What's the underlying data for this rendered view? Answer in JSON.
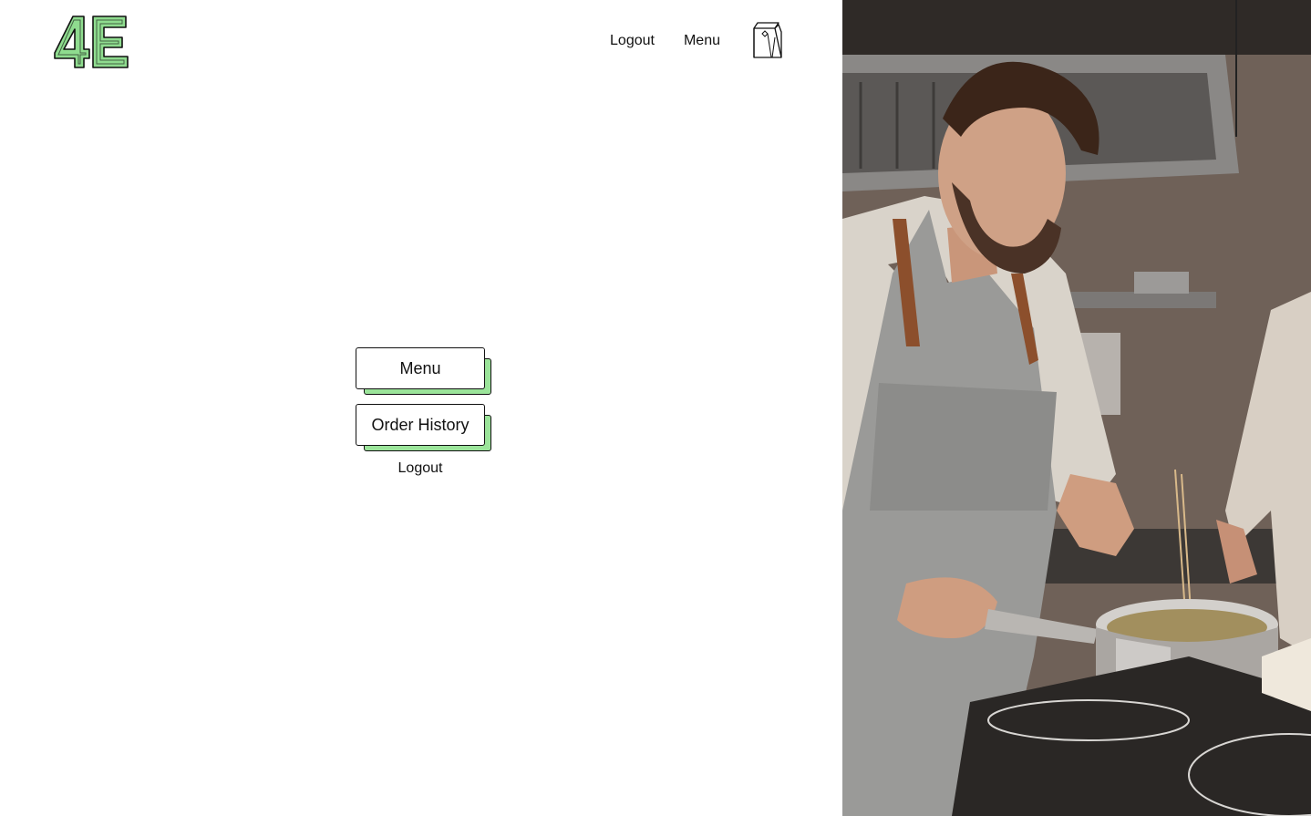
{
  "header": {
    "logo_text": "4E",
    "nav": {
      "logout_label": "Logout",
      "menu_label": "Menu",
      "bag_icon": "shopping-bag-icon"
    }
  },
  "main": {
    "menu_button_label": "Menu",
    "order_history_button_label": "Order History",
    "logout_label": "Logout"
  },
  "hero": {
    "image_alt": "Chef stirring a saucepan in a kitchen"
  },
  "colors": {
    "accent_green": "#9be49a",
    "logo_green": "#8fdc8f",
    "ink": "#111111",
    "background": "#ffffff"
  }
}
